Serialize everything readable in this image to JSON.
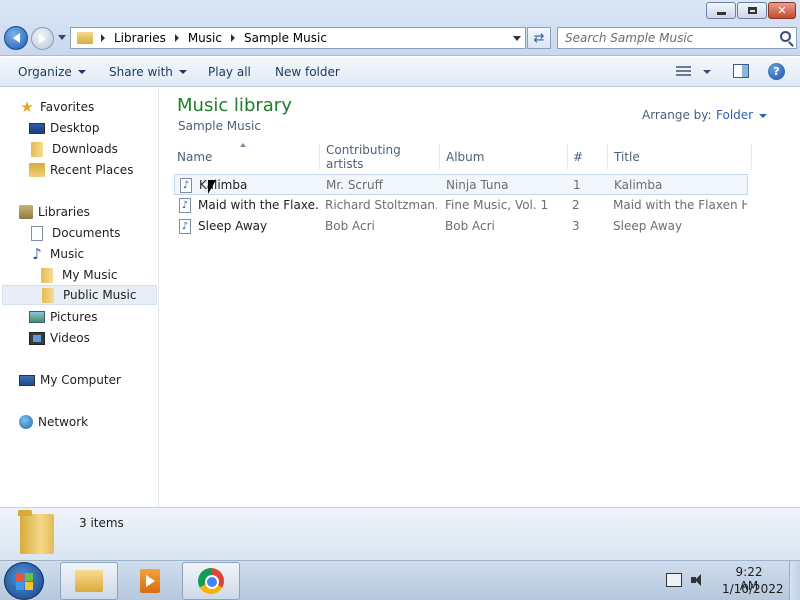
{
  "address": {
    "crumbs": [
      "Libraries",
      "Music",
      "Sample Music"
    ]
  },
  "search": {
    "placeholder": "Search Sample Music"
  },
  "toolbar": {
    "organize": "Organize",
    "share_with": "Share with",
    "play_all": "Play all",
    "new_folder": "New folder"
  },
  "nav": {
    "favorites": "Favorites",
    "desktop": "Desktop",
    "downloads": "Downloads",
    "recent_places": "Recent Places",
    "libraries": "Libraries",
    "documents": "Documents",
    "music": "Music",
    "my_music": "My Music",
    "public_music": "Public Music",
    "pictures": "Pictures",
    "videos": "Videos",
    "my_computer": "My Computer",
    "network": "Network"
  },
  "library": {
    "title": "Music library",
    "subtitle": "Sample Music",
    "arrange_label": "Arrange by:",
    "arrange_value": "Folder"
  },
  "columns": {
    "name": "Name",
    "artists": "Contributing artists",
    "album": "Album",
    "number": "#",
    "title": "Title"
  },
  "files": [
    {
      "name": "Kalimba",
      "artists": "Mr. Scruff",
      "album": "Ninja Tuna",
      "number": "1",
      "title": "Kalimba"
    },
    {
      "name": "Maid with the Flaxe...",
      "artists": "Richard Stoltzman...",
      "album": "Fine Music, Vol. 1",
      "number": "2",
      "title": "Maid with the Flaxen H..."
    },
    {
      "name": "Sleep Away",
      "artists": "Bob Acri",
      "album": "Bob Acri",
      "number": "3",
      "title": "Sleep Away"
    }
  ],
  "details": {
    "count": "3 items"
  },
  "clock": {
    "time": "9:22 AM",
    "date": "1/10/2022"
  },
  "icons": {
    "back": "back-arrow-icon",
    "forward": "forward-arrow-icon",
    "refresh": "refresh-icon",
    "search": "search-icon",
    "help": "help-icon"
  }
}
